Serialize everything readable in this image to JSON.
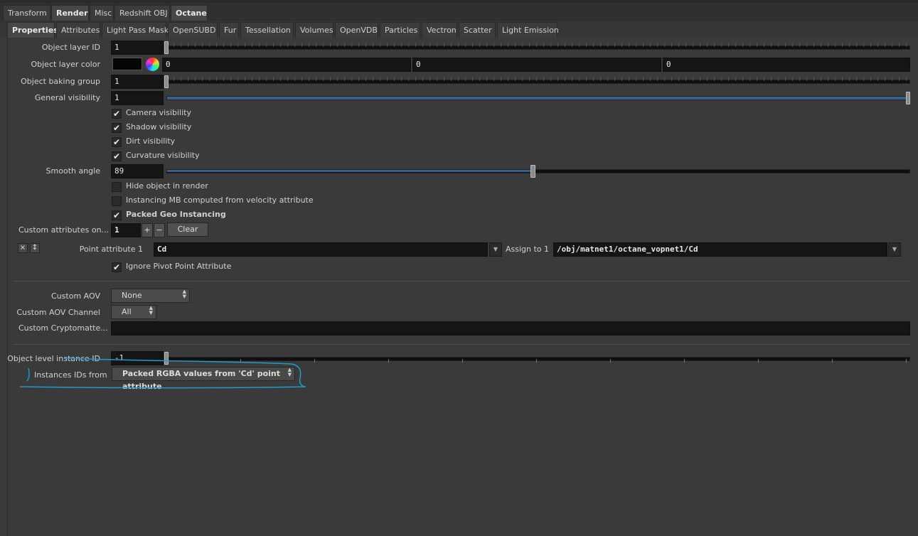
{
  "top_tabs": [
    "Transform",
    "Render",
    "Misc",
    "Redshift OBJ",
    "Octane"
  ],
  "sub_tabs": [
    "Properties",
    "Attributes",
    "Light Pass Mask",
    "OpenSUBD",
    "Fur",
    "Tessellation",
    "Volumes",
    "OpenVDB",
    "Particles",
    "Vectron",
    "Scatter",
    "Light Emission"
  ],
  "params": {
    "object_layer_id": {
      "label": "Object layer ID",
      "value": "1"
    },
    "object_layer_color": {
      "label": "Object layer color",
      "r": "0",
      "g": "0",
      "b": "0"
    },
    "object_baking_group": {
      "label": "Object baking group",
      "value": "1"
    },
    "general_visibility": {
      "label": "General visibility",
      "value": "1"
    },
    "camera_visibility": {
      "label": "Camera visibility",
      "checked": true
    },
    "shadow_visibility": {
      "label": "Shadow visibility",
      "checked": true
    },
    "dirt_visibility": {
      "label": "Dirt visibility",
      "checked": true
    },
    "curvature_visibility": {
      "label": "Curvature visibility",
      "checked": true
    },
    "smooth_angle": {
      "label": "Smooth angle",
      "value": "89"
    },
    "hide_object": {
      "label": "Hide object in render",
      "checked": false
    },
    "instancing_mb": {
      "label": "Instancing MB computed from velocity attribute",
      "checked": false
    },
    "packed_geo": {
      "label": "Packed Geo Instancing",
      "checked": true
    },
    "custom_attributes": {
      "label": "Custom attributes on...",
      "value": "1",
      "plus": "+",
      "minus": "−",
      "clear": "Clear"
    },
    "point_attribute": {
      "label": "Point attribute 1",
      "value": "Cd",
      "assign_label": "Assign to 1",
      "assign_value": "/obj/matnet1/octane_vopnet1/Cd",
      "remove": "×",
      "move": "↕"
    },
    "ignore_pivot": {
      "label": "Ignore Pivot Point Attribute",
      "checked": true
    },
    "custom_aov": {
      "label": "Custom AOV",
      "value": "None"
    },
    "custom_aov_channel": {
      "label": "Custom AOV Channel",
      "value": "All"
    },
    "custom_cryptomatte": {
      "label": "Custom Cryptomatte...",
      "value": ""
    },
    "object_level_instance_id": {
      "label": "Object level instance ID",
      "value": "-1"
    },
    "instances_ids_from": {
      "label": "Instances IDs from",
      "value": "Packed RGBA values from 'Cd' point attribute"
    }
  },
  "colors": {
    "annotation": "#1e9bc8",
    "slider_fill": "#3a5f8a"
  }
}
